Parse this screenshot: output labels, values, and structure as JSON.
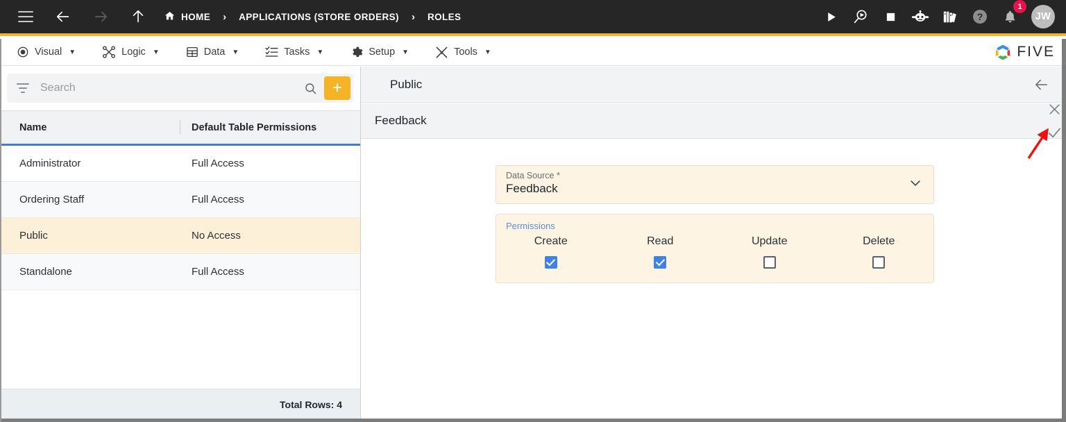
{
  "topbar": {
    "menu_icon": "hamburger-icon",
    "back_icon": "arrow-left-icon",
    "forward_icon": "arrow-right-icon",
    "up_icon": "arrow-up-icon",
    "breadcrumbs": [
      {
        "label": "HOME",
        "icon": "home-icon"
      },
      {
        "label": "APPLICATIONS (STORE ORDERS)",
        "icon": ""
      },
      {
        "label": "ROLES",
        "icon": ""
      }
    ],
    "separator": "›",
    "actions": [
      {
        "name": "run-icon",
        "title": "Run"
      },
      {
        "name": "search-run-icon",
        "title": "Preview"
      },
      {
        "name": "stop-icon",
        "title": "Stop"
      },
      {
        "name": "robot-icon",
        "title": "Assistant"
      },
      {
        "name": "library-icon",
        "title": "Library"
      },
      {
        "name": "help-icon",
        "title": "Help"
      },
      {
        "name": "bell-icon",
        "title": "Notifications"
      }
    ],
    "notification_count": "1",
    "avatar_initials": "JW",
    "accent_color": "#f5b426",
    "bar_color": "#262626"
  },
  "menubar": {
    "items": [
      {
        "label": "Visual",
        "icon": "eye-icon",
        "caret": "▼"
      },
      {
        "label": "Logic",
        "icon": "logic-nodes-icon",
        "caret": "▼"
      },
      {
        "label": "Data",
        "icon": "table-icon",
        "caret": "▼"
      },
      {
        "label": "Tasks",
        "icon": "tasks-list-icon",
        "caret": "▼"
      },
      {
        "label": "Setup",
        "icon": "gear-icon",
        "caret": "▼"
      },
      {
        "label": "Tools",
        "icon": "tools-icon",
        "caret": "▼"
      }
    ],
    "brand": "FIVE"
  },
  "left_panel": {
    "search": {
      "placeholder": "Search",
      "value": ""
    },
    "filter_icon": "filter-icon",
    "search_icon": "search-icon",
    "add_label": "+",
    "table": {
      "columns": [
        "Name",
        "Default Table Permissions"
      ],
      "rows": [
        {
          "name": "Administrator",
          "permissions": "Full Access",
          "selected": false
        },
        {
          "name": "Ordering Staff",
          "permissions": "Full Access",
          "selected": false
        },
        {
          "name": "Public",
          "permissions": "No Access",
          "selected": true
        },
        {
          "name": "Standalone",
          "permissions": "Full Access",
          "selected": false
        }
      ]
    },
    "footer_total": "Total Rows: 4"
  },
  "right_panel": {
    "record_title": "Public",
    "back_icon": "arrow-left-icon",
    "form_title": "Feedback",
    "cancel_icon": "close-icon",
    "confirm_icon": "check-icon",
    "data_source": {
      "label": "Data Source *",
      "value": "Feedback",
      "chevron": "chevron-down-icon"
    },
    "permissions": {
      "legend": "Permissions",
      "items": [
        {
          "label": "Create",
          "checked": true
        },
        {
          "label": "Read",
          "checked": true
        },
        {
          "label": "Update",
          "checked": false
        },
        {
          "label": "Delete",
          "checked": false
        }
      ]
    },
    "annotation": {
      "name": "red-arrow-annotation",
      "color": "#ee1111"
    }
  }
}
